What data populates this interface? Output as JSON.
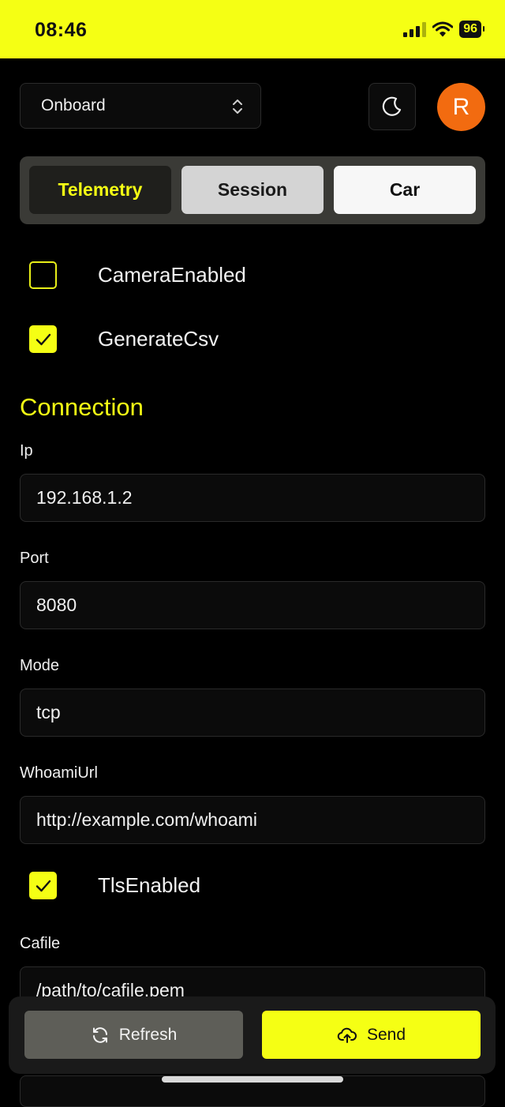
{
  "status_bar": {
    "time": "08:46",
    "battery": "96"
  },
  "header": {
    "select_value": "Onboard",
    "avatar_initial": "R"
  },
  "tabs": [
    {
      "label": "Telemetry",
      "state": "active"
    },
    {
      "label": "Session",
      "state": "inactive"
    },
    {
      "label": "Car",
      "state": "inactive"
    }
  ],
  "options": [
    {
      "label": "CameraEnabled",
      "checked": false
    },
    {
      "label": "GenerateCsv",
      "checked": true
    }
  ],
  "connection": {
    "title": "Connection",
    "fields": [
      {
        "label": "Ip",
        "value": "192.168.1.2"
      },
      {
        "label": "Port",
        "value": "8080"
      },
      {
        "label": "Mode",
        "value": "tcp"
      },
      {
        "label": "WhoamiUrl",
        "value": "http://example.com/whoami"
      }
    ],
    "tls": {
      "label": "TlsEnabled",
      "checked": true
    },
    "cafile": {
      "label": "Cafile",
      "value": "/path/to/cafile.pem"
    }
  },
  "actions": {
    "refresh_label": "Refresh",
    "send_label": "Send"
  },
  "colors": {
    "accent": "#f5ff14",
    "avatar": "#f26b10",
    "background": "#000000"
  },
  "icons": [
    "signal-icon",
    "wifi-icon",
    "battery-icon",
    "chevron-updown-icon",
    "moon-icon",
    "check-icon",
    "refresh-icon",
    "cloud-upload-icon"
  ]
}
